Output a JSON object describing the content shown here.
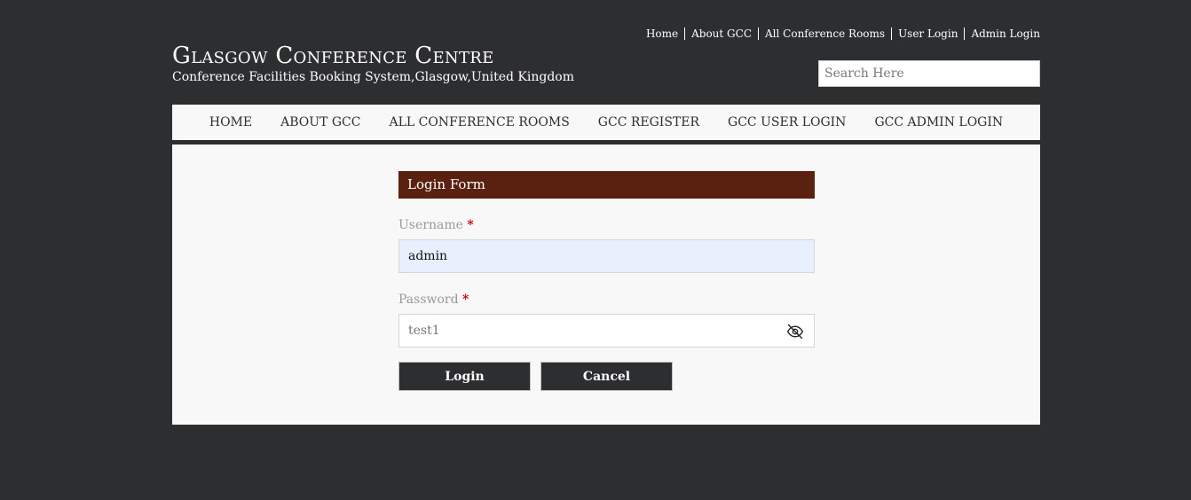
{
  "top_links": {
    "home": "Home",
    "about": "About GCC",
    "rooms": "All Conference Rooms",
    "user_login": "User Login",
    "admin_login": "Admin Login"
  },
  "brand": {
    "title": "Glasgow Conference Centre",
    "subtitle": "Conference Facilities Booking System,Glasgow,United Kingdom"
  },
  "search": {
    "placeholder": "Search Here",
    "value": ""
  },
  "nav": {
    "home": "HOME",
    "about": "ABOUT GCC",
    "rooms": "ALL CONFERENCE ROOMS",
    "register": "GCC REGISTER",
    "user_login": "GCC USER LOGIN",
    "admin_login": "GCC ADMIN LOGIN"
  },
  "login_form": {
    "header": "Login Form",
    "username_label": "Username",
    "password_label": "Password",
    "required_marker": "*",
    "username_value": "admin",
    "password_value": "test1",
    "password_toggle_icon": "eye-slash-icon",
    "login_button": "Login",
    "cancel_button": "Cancel"
  },
  "colors": {
    "background": "#2d2e30",
    "panel": "#f8f8f8",
    "form_header": "#5a2010",
    "autofill": "#e8f0fe",
    "required": "#c00000"
  }
}
